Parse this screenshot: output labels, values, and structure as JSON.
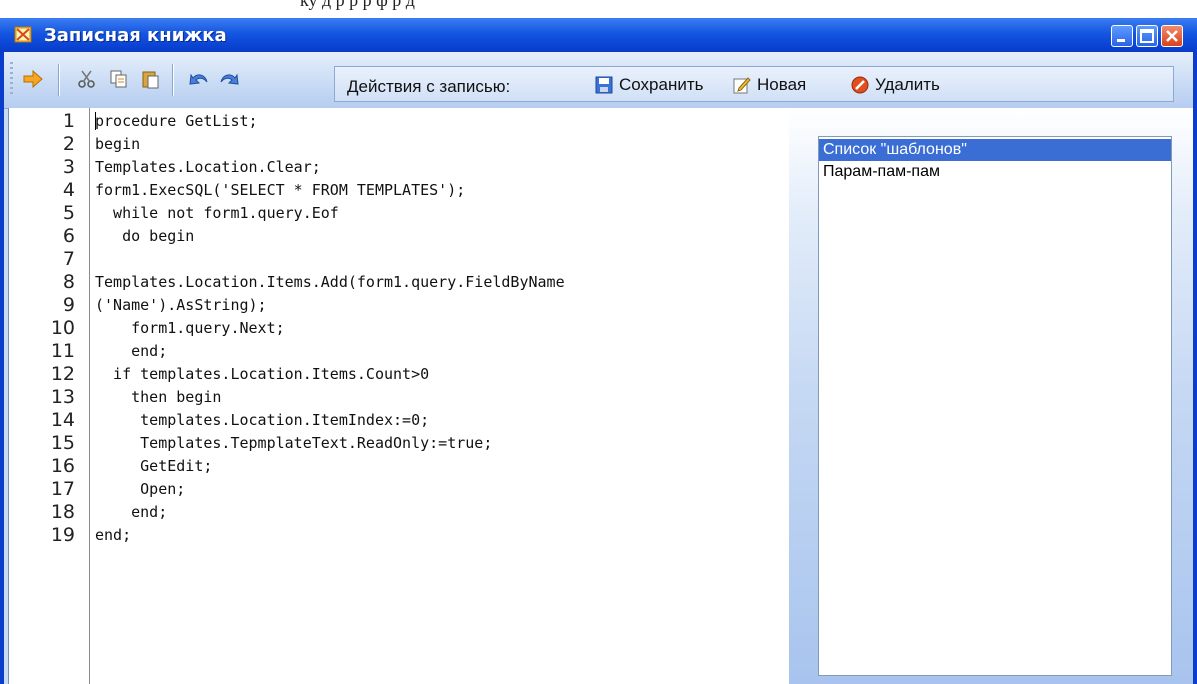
{
  "caption_fragment": "ку    д  р        р            р ф р  д",
  "window": {
    "title": "Записная книжка",
    "controls": [
      "minimize",
      "maximize",
      "close"
    ]
  },
  "toolbar": {
    "icons": [
      "arrow-right-icon",
      "cut-icon",
      "copy-icon",
      "paste-icon",
      "undo-icon",
      "redo-icon"
    ],
    "actions_label": "Действия с записью:",
    "save_label": "Сохранить",
    "new_label": "Новая",
    "delete_label": "Удалить"
  },
  "editor": {
    "line_numbers": [
      "1",
      "2",
      "3",
      "4",
      "5",
      "6",
      "7",
      "8",
      "9",
      "10",
      "11",
      "12",
      "13",
      "14",
      "15",
      "16",
      "17",
      "18",
      "19"
    ],
    "lines": [
      "procedure GetList;",
      "begin",
      "Templates.Location.Clear;",
      "form1.ExecSQL('SELECT * FROM TEMPLATES');",
      "  while not form1.query.Eof",
      "   do begin",
      "",
      "Templates.Location.Items.Add(form1.query.FieldByName",
      "('Name').AsString);",
      "    form1.query.Next;",
      "    end;",
      "  if templates.Location.Items.Count>0",
      "    then begin",
      "     templates.Location.ItemIndex:=0;",
      "     Templates.TepmplateText.ReadOnly:=true;",
      "     GetEdit;",
      "     Open;",
      "    end;",
      "end;"
    ]
  },
  "list": {
    "items": [
      "Список \"шаблонов\"",
      "Парам-пам-пам"
    ],
    "selected_index": 0
  },
  "colors": {
    "title_bar": "#1456e0",
    "selection": "#3a6ed4",
    "toolbar": "#c7daf4"
  }
}
